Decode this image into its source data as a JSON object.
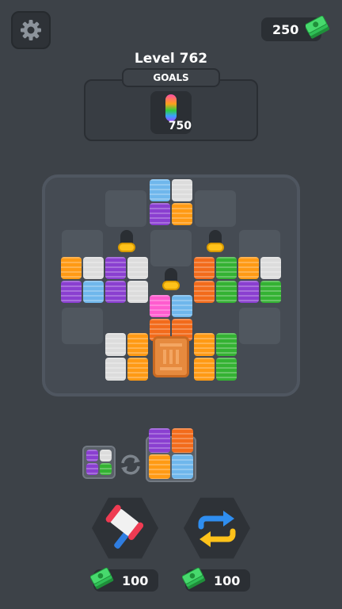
{
  "header": {
    "currency": "250",
    "level": "Level 762"
  },
  "goals": {
    "label": "GOALS",
    "count": "750"
  },
  "tools": [
    {
      "name": "hammer",
      "price": "100"
    },
    {
      "name": "shuffle",
      "price": "100"
    }
  ],
  "colors": {
    "blue": "#6fb7ec",
    "white": "#dcdcdc",
    "purple": "#8a3fd0",
    "orange": "#ff9a14",
    "deep_orange": "#f26b1b",
    "green": "#34b233",
    "pink": "#ff5ccf"
  }
}
